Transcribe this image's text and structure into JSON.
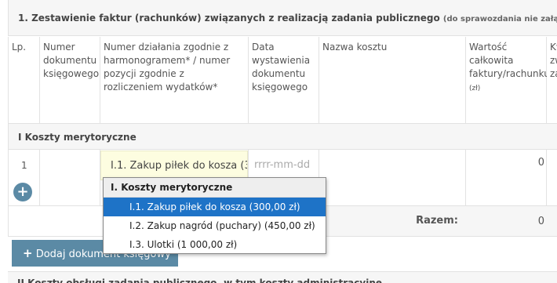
{
  "section": {
    "title": "1. Zestawienie faktur (rachunków) związanych z realizacją zadania publicznego",
    "note": "(do sprawozdania nie załącza się oryginałów"
  },
  "columns": [
    "Lp.",
    "Numer dokumentu księgowego",
    "Numer działania zgodnie z harmonogramem* / numer pozycji zgodnie z rozliczeniem wydatków*",
    "Data wystawienia dokumentu księgowego",
    "Nazwa kosztu",
    "Wartość całkowita faktury/rachunku",
    "Kw zw re za"
  ],
  "column_unit": "(zł)",
  "group_label": "I Koszty merytoryczne",
  "row": {
    "lp": "1",
    "action_selected": "I.1. Zakup piłek do kosza (300,00 zł)",
    "date_placeholder": "rrrr-mm-dd",
    "value": "0"
  },
  "sum": {
    "label": "Razem:",
    "value": "0"
  },
  "add_button": {
    "label": "Dodaj dokument księgowy",
    "icon": "plus-icon"
  },
  "bottom_section": "II Koszty obsługi zadania publicznego, w tym koszty administracyjne",
  "dropdown": {
    "group": "I. Koszty merytoryczne",
    "options": [
      "I.1. Zakup piłek do kosza (300,00 zł)",
      "I.2. Zakup nagród (puchary) (450,00 zł)",
      "I.3. Ulotki (1 000,00 zł)"
    ],
    "selected_index": 0
  },
  "colors": {
    "accent": "#5b8aa5",
    "selected": "#1e73c7",
    "highlight": "#fdfde0"
  }
}
